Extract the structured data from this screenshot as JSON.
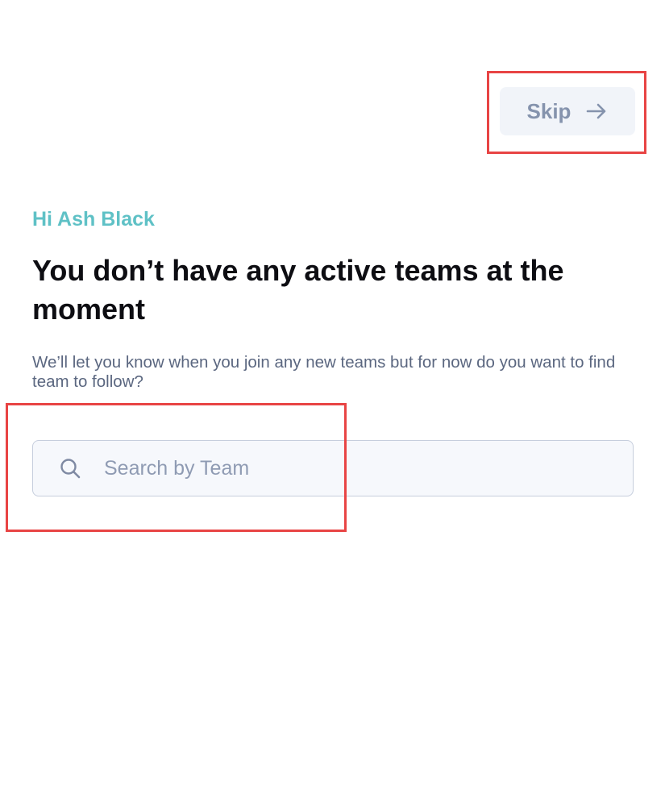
{
  "header": {
    "skip_label": "Skip",
    "skip_icon": "arrow-right-icon"
  },
  "greeting": "Hi Ash Black",
  "title": "You don’t have any active teams at the moment",
  "description": "We’ll let you know when you join any new teams but for now do you want to find team to follow?",
  "search": {
    "placeholder": "Search by Team",
    "value": "",
    "icon": "search-icon"
  },
  "colors": {
    "accent": "#5fc1c6",
    "title": "#0d0d12",
    "muted_text": "#5b6780",
    "skip_bg": "#f1f4f9",
    "skip_text": "#8593ad",
    "input_bg": "#f6f8fc",
    "input_border": "#c6cedd",
    "annotation": "#e84444"
  }
}
